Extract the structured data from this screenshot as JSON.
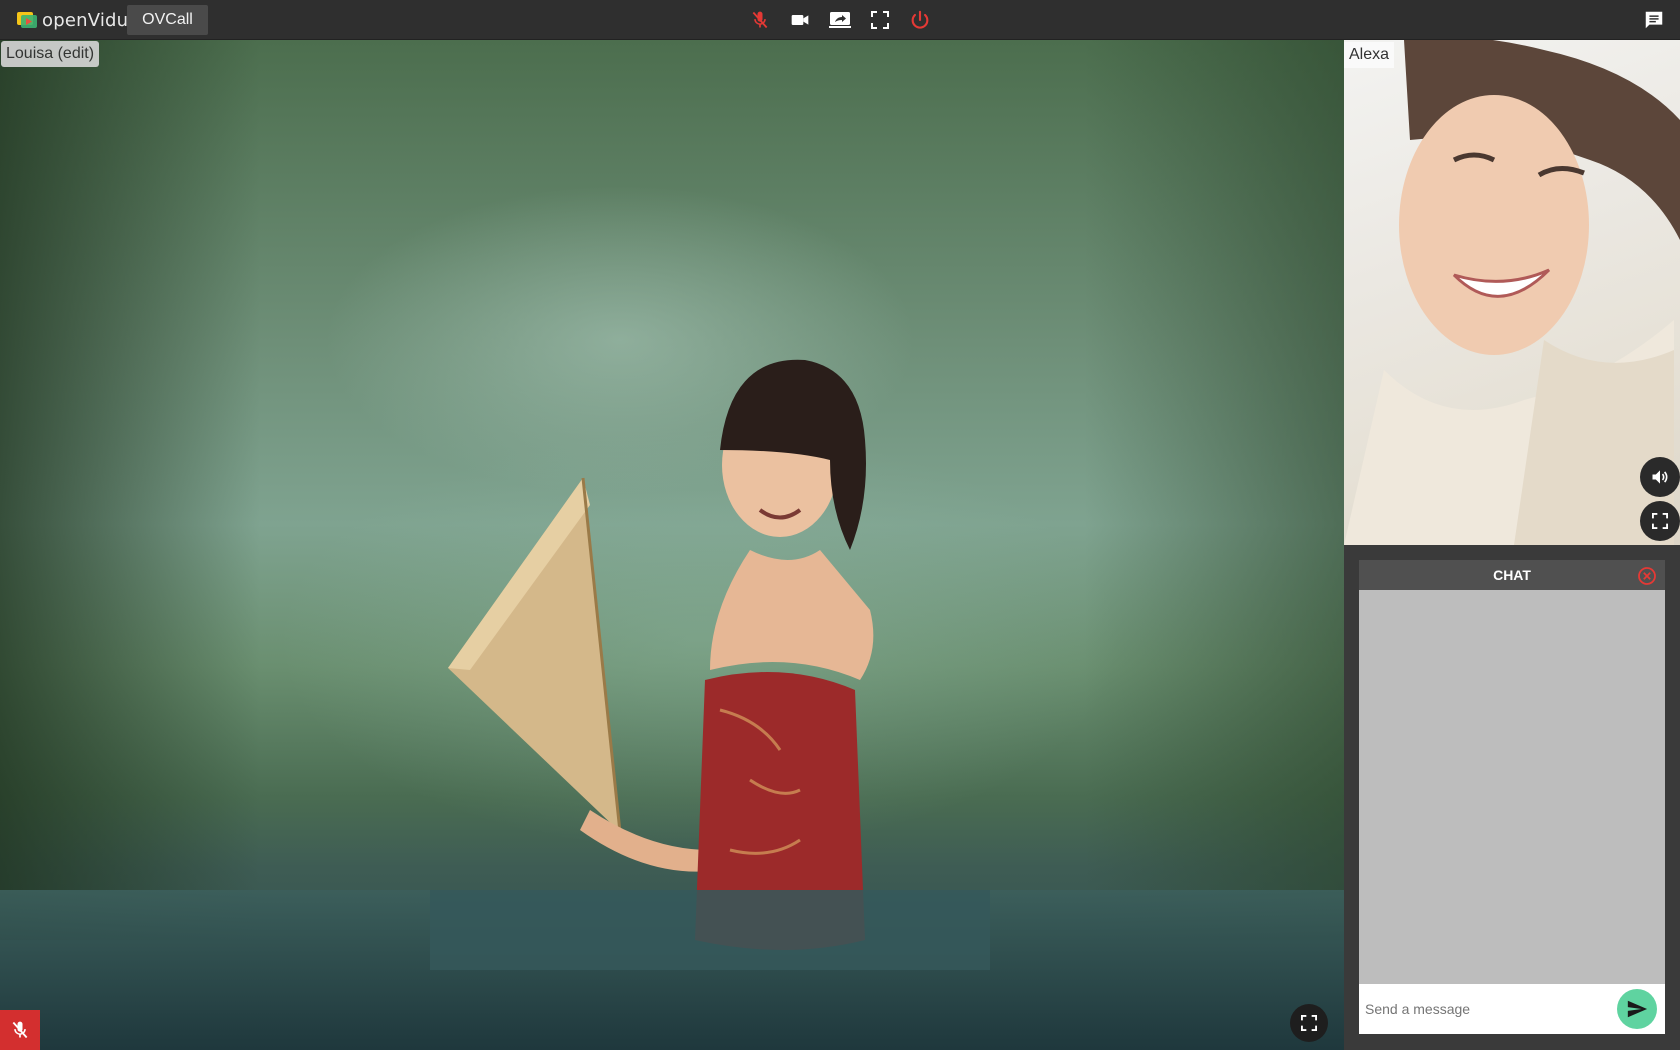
{
  "app": {
    "logo_text": "openVidu",
    "session_name": "OVCall"
  },
  "toolbar": {
    "controls": [
      {
        "name": "mic-muted-icon",
        "color": "#e53935"
      },
      {
        "name": "camera-icon",
        "color": "#ffffff"
      },
      {
        "name": "screen-share-icon",
        "color": "#ffffff"
      },
      {
        "name": "fullscreen-icon",
        "color": "#ffffff"
      },
      {
        "name": "power-leave-icon",
        "color": "#e53935"
      }
    ],
    "chat_icon": "chat-icon"
  },
  "local_stream": {
    "nickname": "Louisa (edit)",
    "audio_muted": true
  },
  "remote_stream": {
    "nickname": "Alexa"
  },
  "chat": {
    "title": "CHAT",
    "input_placeholder": "Send a message",
    "messages": []
  },
  "colors": {
    "toolbar_bg": "#2f2f2f",
    "danger": "#e53935",
    "send_accent": "#5fd3a0"
  }
}
